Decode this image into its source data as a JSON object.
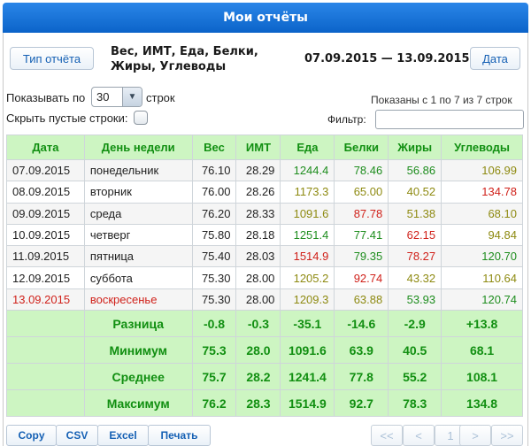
{
  "window": {
    "title": "Мои отчёты"
  },
  "header": {
    "report_type_label": "Тип отчёта",
    "report_title": "Вес, ИМТ, Еда, Белки, Жиры, Углеводы",
    "date_range": "07.09.2015 — 13.09.2015",
    "date_button_label": "Дата"
  },
  "controls": {
    "show_label": "Показывать по",
    "page_size": "30",
    "rows_label": "строк",
    "hide_empty_label": "Скрыть пустые строки:",
    "shown_info": "Показаны с 1 по 7 из 7 строк",
    "filter_label": "Фильтр:",
    "filter_value": ""
  },
  "table": {
    "columns": [
      "Дата",
      "День недели",
      "Вес",
      "ИМТ",
      "Еда",
      "Белки",
      "Жиры",
      "Углеводы"
    ],
    "rows": [
      {
        "date": "07.09.2015",
        "day": "понедельник",
        "weight": "76.10",
        "bmi": "28.29",
        "food": "1244.4",
        "protein": "78.46",
        "fat": "56.86",
        "carbs": "106.99"
      },
      {
        "date": "08.09.2015",
        "day": "вторник",
        "weight": "76.00",
        "bmi": "28.26",
        "food": "1173.3",
        "protein": "65.00",
        "fat": "40.52",
        "carbs": "134.78"
      },
      {
        "date": "09.09.2015",
        "day": "среда",
        "weight": "76.20",
        "bmi": "28.33",
        "food": "1091.6",
        "protein": "87.78",
        "fat": "51.38",
        "carbs": "68.10"
      },
      {
        "date": "10.09.2015",
        "day": "четверг",
        "weight": "75.80",
        "bmi": "28.18",
        "food": "1251.4",
        "protein": "77.41",
        "fat": "62.15",
        "carbs": "94.84"
      },
      {
        "date": "11.09.2015",
        "day": "пятница",
        "weight": "75.40",
        "bmi": "28.03",
        "food": "1514.9",
        "protein": "79.35",
        "fat": "78.27",
        "carbs": "120.70"
      },
      {
        "date": "12.09.2015",
        "day": "суббота",
        "weight": "75.30",
        "bmi": "28.00",
        "food": "1205.2",
        "protein": "92.74",
        "fat": "43.32",
        "carbs": "110.64"
      },
      {
        "date": "13.09.2015",
        "day": "воскресенье",
        "weight": "75.30",
        "bmi": "28.00",
        "food": "1209.3",
        "protein": "63.88",
        "fat": "53.93",
        "carbs": "120.74"
      }
    ],
    "summary": [
      {
        "label": "Разница",
        "weight": "-0.8",
        "bmi": "-0.3",
        "food": "-35.1",
        "protein": "-14.6",
        "fat": "-2.9",
        "carbs": "+13.8"
      },
      {
        "label": "Минимум",
        "weight": "75.3",
        "bmi": "28.0",
        "food": "1091.6",
        "protein": "63.9",
        "fat": "40.5",
        "carbs": "68.1"
      },
      {
        "label": "Среднее",
        "weight": "75.7",
        "bmi": "28.2",
        "food": "1241.4",
        "protein": "77.8",
        "fat": "55.2",
        "carbs": "108.1"
      },
      {
        "label": "Максимум",
        "weight": "76.2",
        "bmi": "28.3",
        "food": "1514.9",
        "protein": "92.7",
        "fat": "78.3",
        "carbs": "134.8"
      }
    ]
  },
  "toolbar": {
    "copy_label": "Copy",
    "csv_label": "CSV",
    "excel_label": "Excel",
    "print_label": "Печать"
  },
  "pagination": {
    "first_label": "<<",
    "prev_label": "<",
    "current_page": "1",
    "next_label": ">",
    "last_label": ">>"
  },
  "colors": {
    "header_blue": "#0b63c9",
    "table_header_green": "#cdf5c2",
    "text_green": "#1e8d1e",
    "text_olive": "#8e8a11",
    "text_red": "#d0211a"
  }
}
